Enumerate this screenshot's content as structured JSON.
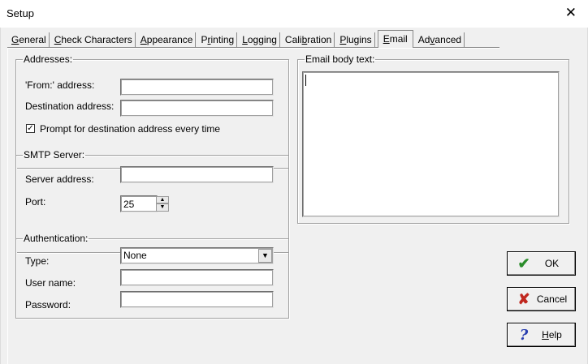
{
  "window": {
    "title": "Setup",
    "close_glyph": "✕"
  },
  "tabs": [
    {
      "pre": "",
      "ul": "G",
      "post": "eneral"
    },
    {
      "pre": "",
      "ul": "C",
      "post": "heck Characters"
    },
    {
      "pre": "",
      "ul": "A",
      "post": "ppearance"
    },
    {
      "pre": "P",
      "ul": "r",
      "post": "inting"
    },
    {
      "pre": "",
      "ul": "L",
      "post": "ogging"
    },
    {
      "pre": "Cali",
      "ul": "b",
      "post": "ration"
    },
    {
      "pre": "",
      "ul": "P",
      "post": "lugins"
    },
    {
      "pre": "",
      "ul": "E",
      "post": "mail"
    },
    {
      "pre": "Ad",
      "ul": "v",
      "post": "anced"
    }
  ],
  "active_tab": 7,
  "addresses": {
    "legend": "Addresses:",
    "from_label": "'From:' address:",
    "from_value": "",
    "dest_label": "Destination address:",
    "dest_value": "",
    "prompt_checked": true,
    "prompt_check_glyph": "✓",
    "prompt_label": "Prompt for destination address every time"
  },
  "smtp": {
    "legend": "SMTP Server:",
    "server_label": "Server address:",
    "server_value": "",
    "port_label": "Port:",
    "port_value": "25",
    "spin_up": "▲",
    "spin_down": "▼"
  },
  "auth": {
    "legend": "Authentication:",
    "type_label": "Type:",
    "type_value": "None",
    "dropdown_glyph": "▼",
    "user_label": "User name:",
    "user_value": "",
    "pass_label": "Password:",
    "pass_value": ""
  },
  "email_body": {
    "legend": "Email body text:",
    "value": ""
  },
  "buttons": {
    "ok": {
      "icon": "✔",
      "label": "OK"
    },
    "cancel": {
      "icon": "✘",
      "label": "Cancel"
    },
    "help": {
      "icon": "?",
      "label_ul": "H",
      "label_rest": "elp"
    }
  },
  "colors": {
    "ok_icon": "#2a8c2a",
    "cancel_icon": "#c0281f",
    "help_icon": "#2a3fb0"
  }
}
